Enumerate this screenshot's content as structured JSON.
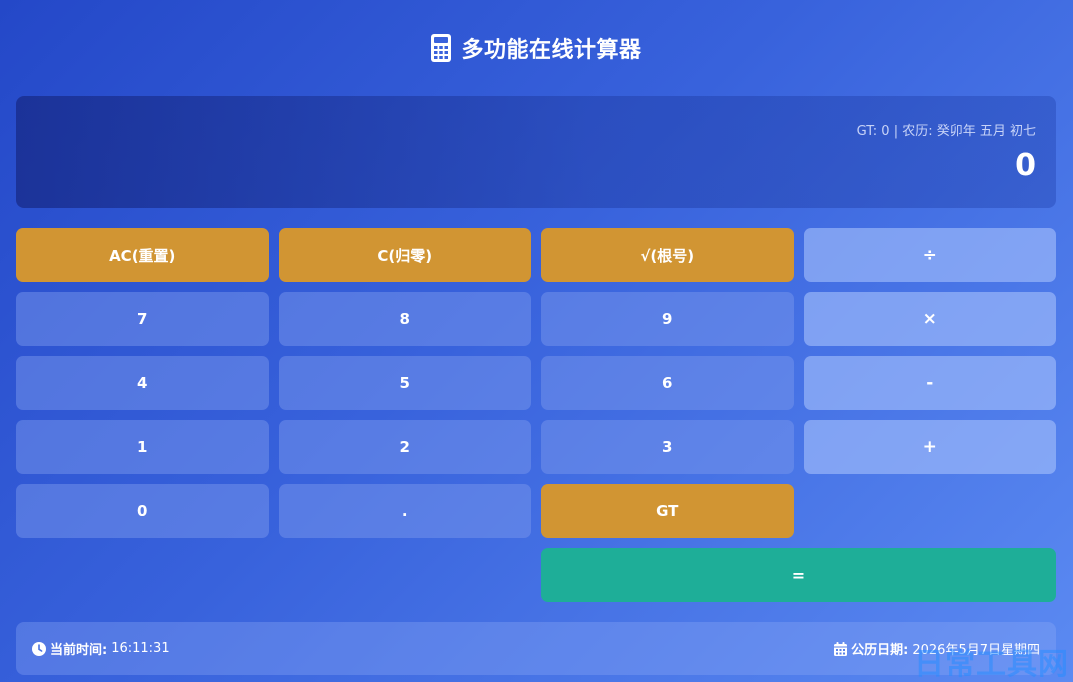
{
  "header": {
    "title": "多功能在线计算器",
    "icon": "calculator-icon"
  },
  "display": {
    "gt_label": "GT: ",
    "gt_value": "0",
    "separator": " | ",
    "lunar_label": "农历: ",
    "lunar_value": "癸卯年 五月 初七",
    "value": "0"
  },
  "keys": {
    "ac": "AC(重置)",
    "c": "C(归零)",
    "sqrt": "√(根号)",
    "divide": "÷",
    "seven": "7",
    "eight": "8",
    "nine": "9",
    "multiply": "×",
    "four": "4",
    "five": "5",
    "six": "6",
    "minus": "-",
    "one": "1",
    "two": "2",
    "three": "3",
    "plus": "+",
    "zero": "0",
    "dot": ".",
    "gt": "GT",
    "equals": "="
  },
  "status": {
    "time_label": "当前时间:",
    "time_value": "16:11:31",
    "date_label": "公历日期:",
    "date_value": "2026年5月7日星期四",
    "time_icon": "clock-icon",
    "date_icon": "calendar-icon"
  },
  "watermark": "日常工具网",
  "colors": {
    "function_key": "#d19533",
    "equals_key": "#1eae98",
    "background_start": "#2448c8",
    "background_end": "#5b8af2"
  }
}
